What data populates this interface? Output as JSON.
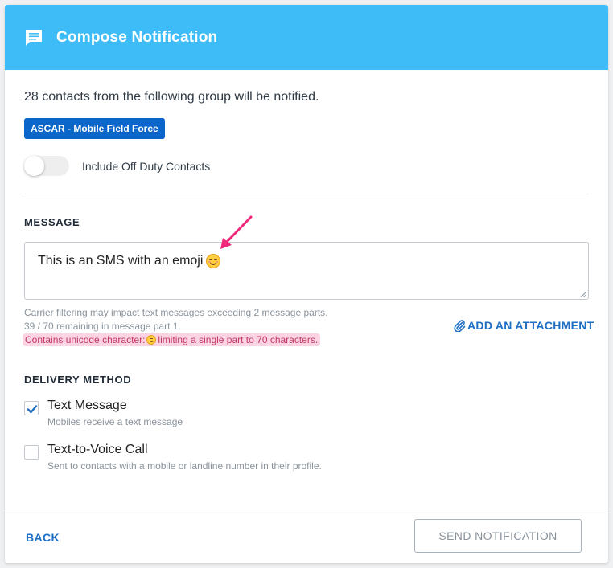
{
  "header": {
    "title": "Compose Notification",
    "icon": "message-icon",
    "bg_color": "#3ebcf7"
  },
  "recipients": {
    "summary": "28 contacts from the following group will be notified.",
    "group_badge": "ASCAR - Mobile Field Force",
    "off_duty_toggle_label": "Include Off Duty Contacts",
    "off_duty_toggle_on": false
  },
  "message": {
    "section_label": "MESSAGE",
    "text": "This is an SMS with an emoji",
    "hint_carrier": "Carrier filtering may impact text messages exceeding 2 message parts.",
    "hint_remaining": "39 / 70 remaining in message part 1.",
    "unicode_warning_prefix": "Contains unicode character:",
    "unicode_warning_suffix": "limiting a single part to 70 characters.",
    "attach_label": "ADD AN ATTACHMENT"
  },
  "delivery": {
    "section_label": "DELIVERY METHOD",
    "options": [
      {
        "title": "Text Message",
        "desc": "Mobiles receive a text message",
        "checked": true
      },
      {
        "title": "Text-to-Voice Call",
        "desc": "Sent to contacts with a mobile or landline number in their profile.",
        "checked": false
      }
    ]
  },
  "footer": {
    "back_label": "BACK",
    "send_label": "SEND NOTIFICATION"
  },
  "colors": {
    "accent": "#1d6ec4",
    "badge": "#0a66c8",
    "warning_text": "#c03a64",
    "warning_bg": "#fbd3e2",
    "annotation_arrow": "#ef2a7b"
  }
}
